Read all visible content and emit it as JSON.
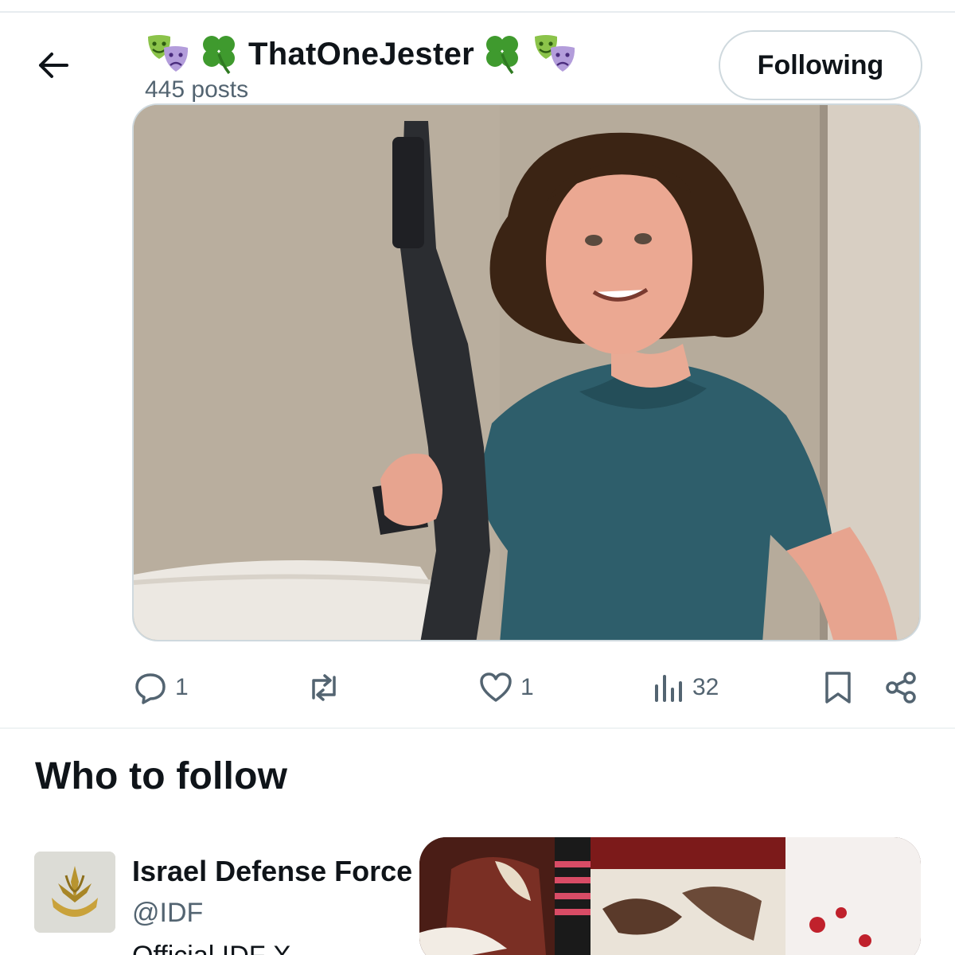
{
  "header": {
    "display_name": "ThatOneJester",
    "post_count": "445 posts",
    "follow_label": "Following",
    "name_emojis": [
      "performing-arts",
      "four-leaf-clover"
    ]
  },
  "post": {
    "image_description_icon": "photo",
    "actions": {
      "reply_count": "1",
      "retweet_count": "",
      "like_count": "1",
      "views_count": "32"
    }
  },
  "who_to_follow": {
    "title": "Who to follow",
    "suggestions": [
      {
        "name": "Israel Defense Force",
        "handle": "@IDF",
        "bio": "Official IDF X"
      }
    ]
  },
  "colors": {
    "text_primary": "#0f1419",
    "text_secondary": "#536471",
    "border": "#cfd9de",
    "clover_green": "#3f9a2e"
  }
}
